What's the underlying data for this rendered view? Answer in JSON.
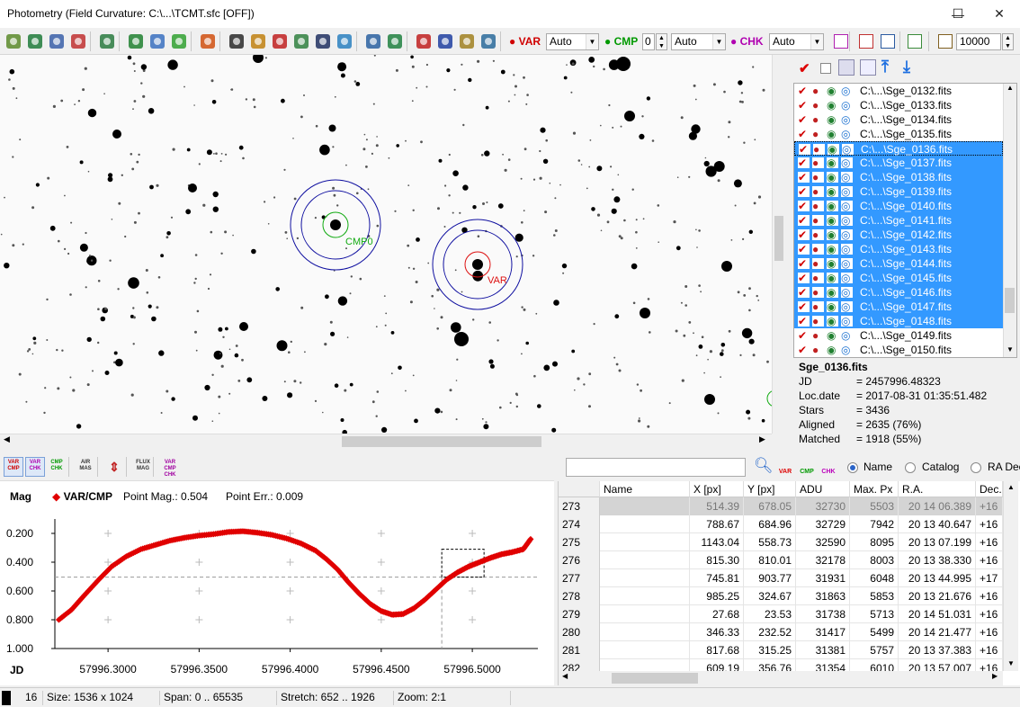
{
  "window": {
    "title": "Photometry (Field Curvature: C:\\...\\TCMT.sfc [OFF])",
    "minimize": "—",
    "maximize": "☐",
    "close": "✕"
  },
  "toolbar": {
    "var_label": "VAR",
    "var_mode": "Auto",
    "cmp_label": "CMP",
    "cmp_index": "0",
    "cmp_mode": "Auto",
    "chk_label": "CHK",
    "chk_mode": "Auto",
    "limit": "10000"
  },
  "image": {
    "cmp_label": "CMP0",
    "var_label": "VAR"
  },
  "files": [
    {
      "name": "C:\\...\\Sge_0132.fits",
      "selected": false
    },
    {
      "name": "C:\\...\\Sge_0133.fits",
      "selected": false
    },
    {
      "name": "C:\\...\\Sge_0134.fits",
      "selected": false
    },
    {
      "name": "C:\\...\\Sge_0135.fits",
      "selected": false
    },
    {
      "name": "C:\\...\\Sge_0136.fits",
      "selected": true,
      "current": true
    },
    {
      "name": "C:\\...\\Sge_0137.fits",
      "selected": true
    },
    {
      "name": "C:\\...\\Sge_0138.fits",
      "selected": true
    },
    {
      "name": "C:\\...\\Sge_0139.fits",
      "selected": true
    },
    {
      "name": "C:\\...\\Sge_0140.fits",
      "selected": true
    },
    {
      "name": "C:\\...\\Sge_0141.fits",
      "selected": true
    },
    {
      "name": "C:\\...\\Sge_0142.fits",
      "selected": true
    },
    {
      "name": "C:\\...\\Sge_0143.fits",
      "selected": true
    },
    {
      "name": "C:\\...\\Sge_0144.fits",
      "selected": true
    },
    {
      "name": "C:\\...\\Sge_0145.fits",
      "selected": true
    },
    {
      "name": "C:\\...\\Sge_0146.fits",
      "selected": true
    },
    {
      "name": "C:\\...\\Sge_0147.fits",
      "selected": true
    },
    {
      "name": "C:\\...\\Sge_0148.fits",
      "selected": true
    },
    {
      "name": "C:\\...\\Sge_0149.fits",
      "selected": false
    },
    {
      "name": "C:\\...\\Sge_0150.fits",
      "selected": false
    }
  ],
  "info": {
    "file": "Sge_0136.fits",
    "rows": [
      {
        "key": "JD",
        "value": "= 2457996.48323"
      },
      {
        "key": "Loc.date",
        "value": "= 2017-08-31 01:35:51.482"
      },
      {
        "key": "Stars",
        "value": "= 3436"
      },
      {
        "key": "Aligned",
        "value": "= 2635 (76%)"
      },
      {
        "key": "Matched",
        "value": "= 1918 (55%)"
      }
    ]
  },
  "plot_tools": [
    "VAR CMP",
    "VAR CHK",
    "CMP CHK",
    "AIR MAS",
    "",
    "FLUX MAG",
    "VAR CMP CHK"
  ],
  "plot": {
    "ylabel": "Mag",
    "series_label": "VAR/CMP",
    "point_mag_label": "Point Mag.:",
    "point_mag": "0.504",
    "point_err_label": "Point Err.:",
    "point_err": "0.009",
    "xlabel": "JD"
  },
  "chart_data": {
    "type": "scatter",
    "title": "",
    "xlabel": "JD",
    "ylabel": "Mag",
    "x_tick_labels": [
      "57996.3000",
      "57996.3500",
      "57996.4000",
      "57996.4500",
      "57996.5000"
    ],
    "y_tick_labels": [
      "0.200",
      "0.400",
      "0.600",
      "0.800",
      "1.000"
    ],
    "x_ticks": [
      57996.3,
      57996.35,
      57996.4,
      57996.45,
      57996.5
    ],
    "y_ticks": [
      0.2,
      0.4,
      0.6,
      0.8,
      1.0
    ],
    "xlim": [
      57996.2708,
      57996.536
    ],
    "ylim": [
      0.1,
      1.0
    ],
    "y_inverted": true,
    "reference_point": {
      "x": 57996.48323,
      "y": 0.504
    },
    "series": [
      {
        "name": "VAR/CMP",
        "color": "#e00000",
        "x": [
          57996.273,
          57996.28,
          57996.287,
          57996.295,
          57996.302,
          57996.31,
          57996.318,
          57996.326,
          57996.334,
          57996.342,
          57996.35,
          57996.358,
          57996.366,
          57996.374,
          57996.382,
          57996.39,
          57996.398,
          57996.406,
          57996.414,
          57996.42,
          57996.426,
          57996.432,
          57996.438,
          57996.444,
          57996.45,
          57996.456,
          57996.462,
          57996.468,
          57996.474,
          57996.48,
          57996.486,
          57996.492,
          57996.498,
          57996.504,
          57996.51,
          57996.516,
          57996.522,
          57996.528,
          57996.532
        ],
        "values": [
          0.8,
          0.73,
          0.63,
          0.52,
          0.43,
          0.36,
          0.31,
          0.28,
          0.25,
          0.23,
          0.215,
          0.205,
          0.19,
          0.185,
          0.195,
          0.21,
          0.235,
          0.27,
          0.32,
          0.38,
          0.45,
          0.54,
          0.62,
          0.69,
          0.74,
          0.765,
          0.76,
          0.72,
          0.66,
          0.59,
          0.52,
          0.47,
          0.43,
          0.4,
          0.37,
          0.345,
          0.33,
          0.31,
          0.24
        ]
      }
    ]
  },
  "table": {
    "search_value": "",
    "radio_name": "Name",
    "radio_catalog": "Catalog",
    "radio_radec": "RA Dec",
    "columns": [
      "",
      "Name",
      "X [px]",
      "Y [px]",
      "ADU",
      "Max. Px",
      "R.A.",
      "Dec."
    ],
    "rows": [
      [
        "273",
        "",
        "514.39",
        "678.05",
        "32730",
        "5503",
        "20 14 06.389",
        "+16"
      ],
      [
        "274",
        "",
        "788.67",
        "684.96",
        "32729",
        "7942",
        "20 13 40.647",
        "+16"
      ],
      [
        "275",
        "",
        "1143.04",
        "558.73",
        "32590",
        "8095",
        "20 13 07.199",
        "+16"
      ],
      [
        "276",
        "",
        "815.30",
        "810.01",
        "32178",
        "8003",
        "20 13 38.330",
        "+16"
      ],
      [
        "277",
        "",
        "745.81",
        "903.77",
        "31931",
        "6048",
        "20 13 44.995",
        "+17"
      ],
      [
        "278",
        "",
        "985.25",
        "324.67",
        "31863",
        "5853",
        "20 13 21.676",
        "+16"
      ],
      [
        "279",
        "",
        "27.68",
        "23.53",
        "31738",
        "5713",
        "20 14 51.031",
        "+16"
      ],
      [
        "280",
        "",
        "346.33",
        "232.52",
        "31417",
        "5499",
        "20 14 21.477",
        "+16"
      ],
      [
        "281",
        "",
        "817.68",
        "315.25",
        "31381",
        "5757",
        "20 13 37.383",
        "+16"
      ],
      [
        "282",
        "",
        "609.19",
        "356.76",
        "31354",
        "6010",
        "20 13 57.007",
        "+16"
      ]
    ]
  },
  "status": {
    "count": "16",
    "size": "Size: 1536 x 1024",
    "span": "Span: 0 .. 65535",
    "stretch": "Stretch: 652 .. 1926",
    "zoom": "Zoom: 2:1"
  }
}
